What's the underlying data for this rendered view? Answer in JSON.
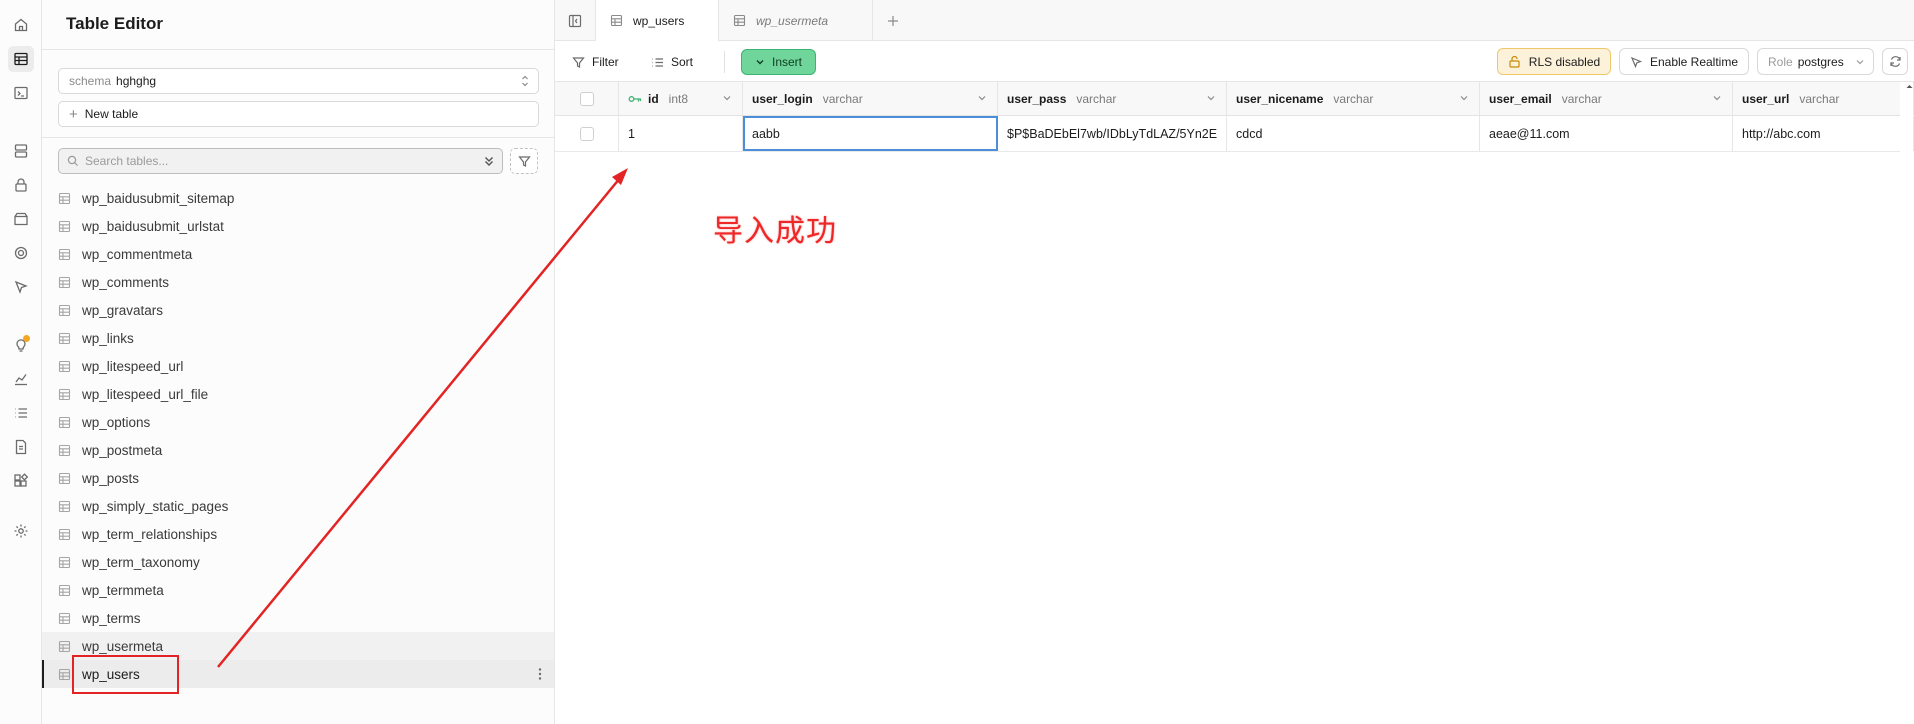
{
  "sidebar": {
    "title": "Table Editor",
    "schema_label": "schema",
    "schema_value": "hghghg",
    "new_table_label": "New table",
    "search_placeholder": "Search tables...",
    "tables": [
      {
        "name": "wp_baidusubmit_sitemap"
      },
      {
        "name": "wp_baidusubmit_urlstat"
      },
      {
        "name": "wp_commentmeta"
      },
      {
        "name": "wp_comments"
      },
      {
        "name": "wp_gravatars"
      },
      {
        "name": "wp_links"
      },
      {
        "name": "wp_litespeed_url"
      },
      {
        "name": "wp_litespeed_url_file"
      },
      {
        "name": "wp_options"
      },
      {
        "name": "wp_postmeta"
      },
      {
        "name": "wp_posts"
      },
      {
        "name": "wp_simply_static_pages"
      },
      {
        "name": "wp_term_relationships"
      },
      {
        "name": "wp_term_taxonomy"
      },
      {
        "name": "wp_termmeta"
      },
      {
        "name": "wp_terms"
      },
      {
        "name": "wp_usermeta"
      },
      {
        "name": "wp_users"
      }
    ]
  },
  "tabs": [
    {
      "label": "wp_users",
      "active": true
    },
    {
      "label": "wp_usermeta",
      "active": false
    }
  ],
  "toolbar": {
    "filter_label": "Filter",
    "sort_label": "Sort",
    "insert_label": "Insert",
    "rls_label": "RLS disabled",
    "realtime_label": "Enable Realtime",
    "role_label": "Role",
    "role_value": "postgres"
  },
  "grid": {
    "columns": [
      {
        "name": "id",
        "type": "int8"
      },
      {
        "name": "user_login",
        "type": "varchar"
      },
      {
        "name": "user_pass",
        "type": "varchar"
      },
      {
        "name": "user_nicename",
        "type": "varchar"
      },
      {
        "name": "user_email",
        "type": "varchar"
      },
      {
        "name": "user_url",
        "type": "varchar"
      }
    ],
    "rows": [
      [
        "1",
        "aabb",
        "$P$BaDEbEl7wb/IDbLyTdLAZ/5Yn2E",
        "cdcd",
        "aeae@11.com",
        "http://abc.com"
      ]
    ]
  },
  "annotation": {
    "text": "导入成功",
    "color": "#ee2828"
  },
  "colors": {
    "insert_green": "#6fd59a",
    "rls_amber": "#fcf1d9",
    "selection_blue": "#4a8fd8",
    "annotation_red": "#e32424"
  }
}
